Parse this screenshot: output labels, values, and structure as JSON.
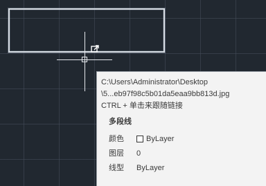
{
  "tooltip": {
    "path_line1": "C:\\Users\\Administrator\\Desktop",
    "path_line2": "\\5...eb97f98c5b01da5eaa9bb813d.jpg",
    "hint": "CTRL + 单击来跟随链接",
    "object_type": "多段线",
    "properties": [
      {
        "label": "颜色",
        "value": "ByLayer",
        "swatch_color": "#ffffff"
      },
      {
        "label": "图层",
        "value": "0"
      },
      {
        "label": "线型",
        "value": "ByLayer"
      }
    ]
  },
  "icons": {
    "cursor": "crosshair-icon",
    "hyperlink": "hyperlink-icon"
  },
  "colors": {
    "background": "#212830",
    "grid": "#464e5c",
    "selection": "#d6dce3",
    "tooltip_bg": "#f3f3f3"
  }
}
